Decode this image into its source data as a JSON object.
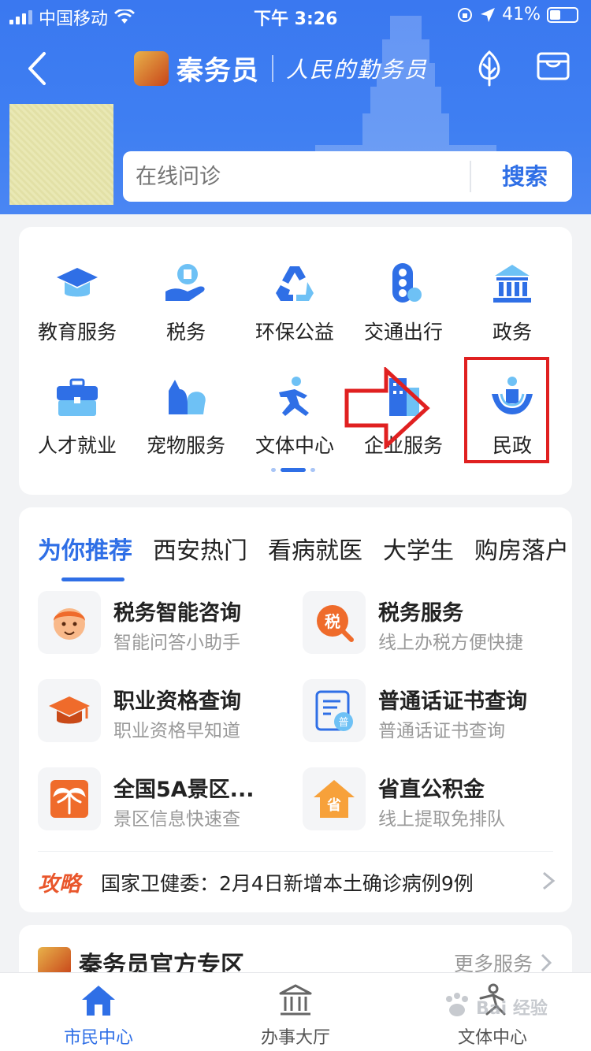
{
  "status_bar": {
    "carrier": "中国移动",
    "time": "下午 3:26",
    "battery": "41%"
  },
  "header": {
    "app_name": "秦务员",
    "slogan": "人民的勤务员",
    "search": {
      "placeholder": "在线问诊",
      "button": "搜索"
    }
  },
  "services": [
    {
      "label": "教育服务",
      "icon": "graduation-cap-icon"
    },
    {
      "label": "税务",
      "icon": "tax-hand-icon"
    },
    {
      "label": "环保公益",
      "icon": "recycle-icon"
    },
    {
      "label": "交通出行",
      "icon": "traffic-light-icon"
    },
    {
      "label": "政务",
      "icon": "government-building-icon"
    },
    {
      "label": "人才就业",
      "icon": "briefcase-icon"
    },
    {
      "label": "宠物服务",
      "icon": "pet-icon"
    },
    {
      "label": "文体中心",
      "icon": "runner-icon"
    },
    {
      "label": "企业服务",
      "icon": "enterprise-icon"
    },
    {
      "label": "民政",
      "icon": "civil-affairs-icon"
    }
  ],
  "carousel": {
    "pages": 3,
    "active": 1
  },
  "recommend": {
    "tabs": [
      "为你推荐",
      "西安热门",
      "看病就医",
      "大学生",
      "购房落户"
    ],
    "active_tab": 0,
    "items": [
      {
        "title": "税务智能咨询",
        "subtitle": "智能问答小助手",
        "icon": "assistant-icon"
      },
      {
        "title": "税务服务",
        "subtitle": "线上办税方便快捷",
        "icon": "tax-search-icon"
      },
      {
        "title": "职业资格查询",
        "subtitle": "职业资格早知道",
        "icon": "mortarboard-icon"
      },
      {
        "title": "普通话证书查询",
        "subtitle": "普通话证书查询",
        "icon": "certificate-icon"
      },
      {
        "title": "全国5A景区...",
        "subtitle": "景区信息快速查",
        "icon": "palm-tree-icon"
      },
      {
        "title": "省直公积金",
        "subtitle": "线上提取免排队",
        "icon": "housing-fund-icon"
      }
    ],
    "news": {
      "tag": "攻略",
      "text": "国家卫健委：2月4日新增本土确诊病例9例"
    }
  },
  "official_zone": {
    "title": "秦务员官方专区",
    "more": "更多服务"
  },
  "bottom_nav": [
    {
      "label": "市民中心",
      "icon": "home-icon",
      "active": true
    },
    {
      "label": "办事大厅",
      "icon": "hall-icon",
      "active": false
    },
    {
      "label": "文体中心",
      "icon": "culture-sports-icon",
      "active": false
    }
  ],
  "watermark": "Bai 经验",
  "colors": {
    "primary": "#2f6fe6",
    "header": "#3f7ff2",
    "annotation": "#e02020",
    "accent_orange": "#ef6b2b"
  }
}
